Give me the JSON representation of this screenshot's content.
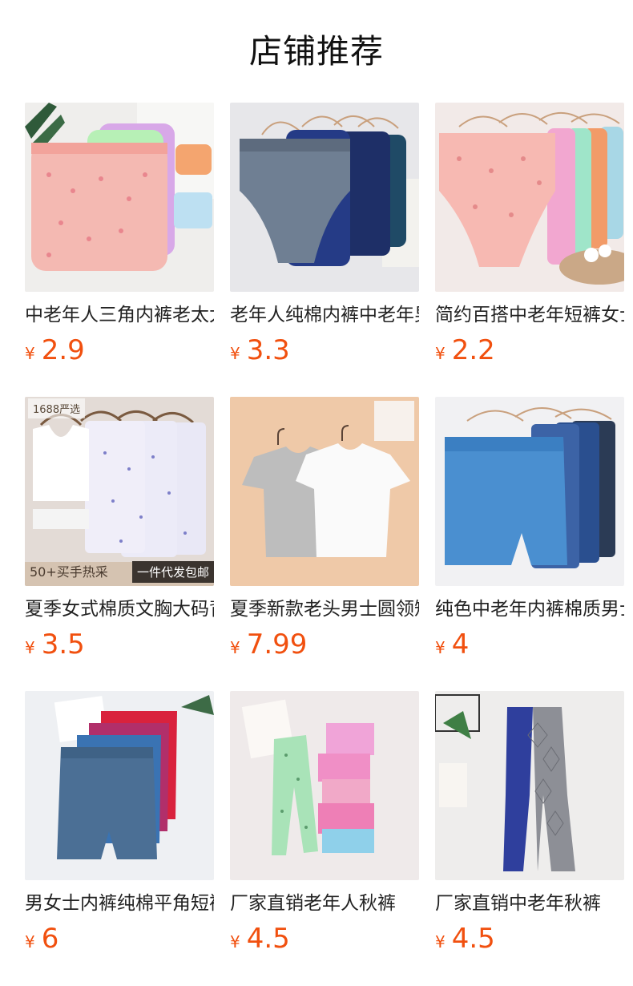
{
  "page_title": "店铺推荐",
  "currency": "¥",
  "products": [
    {
      "title": "中老年人三角内裤老太太",
      "price": "2.9",
      "image": "pink-floral-briefs-photo"
    },
    {
      "title": "老年人纯棉内裤中老年男",
      "price": "3.3",
      "image": "gray-navy-briefs-on-hangers-photo"
    },
    {
      "title": "简约百搭中老年短裤女士",
      "price": "2.2",
      "image": "pastel-briefs-on-hangers-photo"
    },
    {
      "title": "夏季女式棉质文胸大码背心",
      "price": "3.5",
      "image": "white-floral-vests-photo",
      "badge_top": "1688严选",
      "badge_left": "50+买手热采",
      "badge_right": "一件代发包邮"
    },
    {
      "title": "夏季新款老头男士圆领短袖",
      "price": "7.99",
      "image": "gray-white-tshirts-photo"
    },
    {
      "title": "纯色中老年内裤棉质男士",
      "price": "4",
      "image": "blue-boxer-shorts-on-hangers-photo"
    },
    {
      "title": "男女士内裤纯棉平角短裤",
      "price": "6",
      "image": "colored-boxer-shorts-stack-photo"
    },
    {
      "title": "厂家直销老年人秋裤",
      "price": "4.5",
      "image": "floral-long-johns-photo"
    },
    {
      "title": "厂家直销中老年秋裤",
      "price": "4.5",
      "image": "blue-gray-long-johns-photo"
    }
  ]
}
